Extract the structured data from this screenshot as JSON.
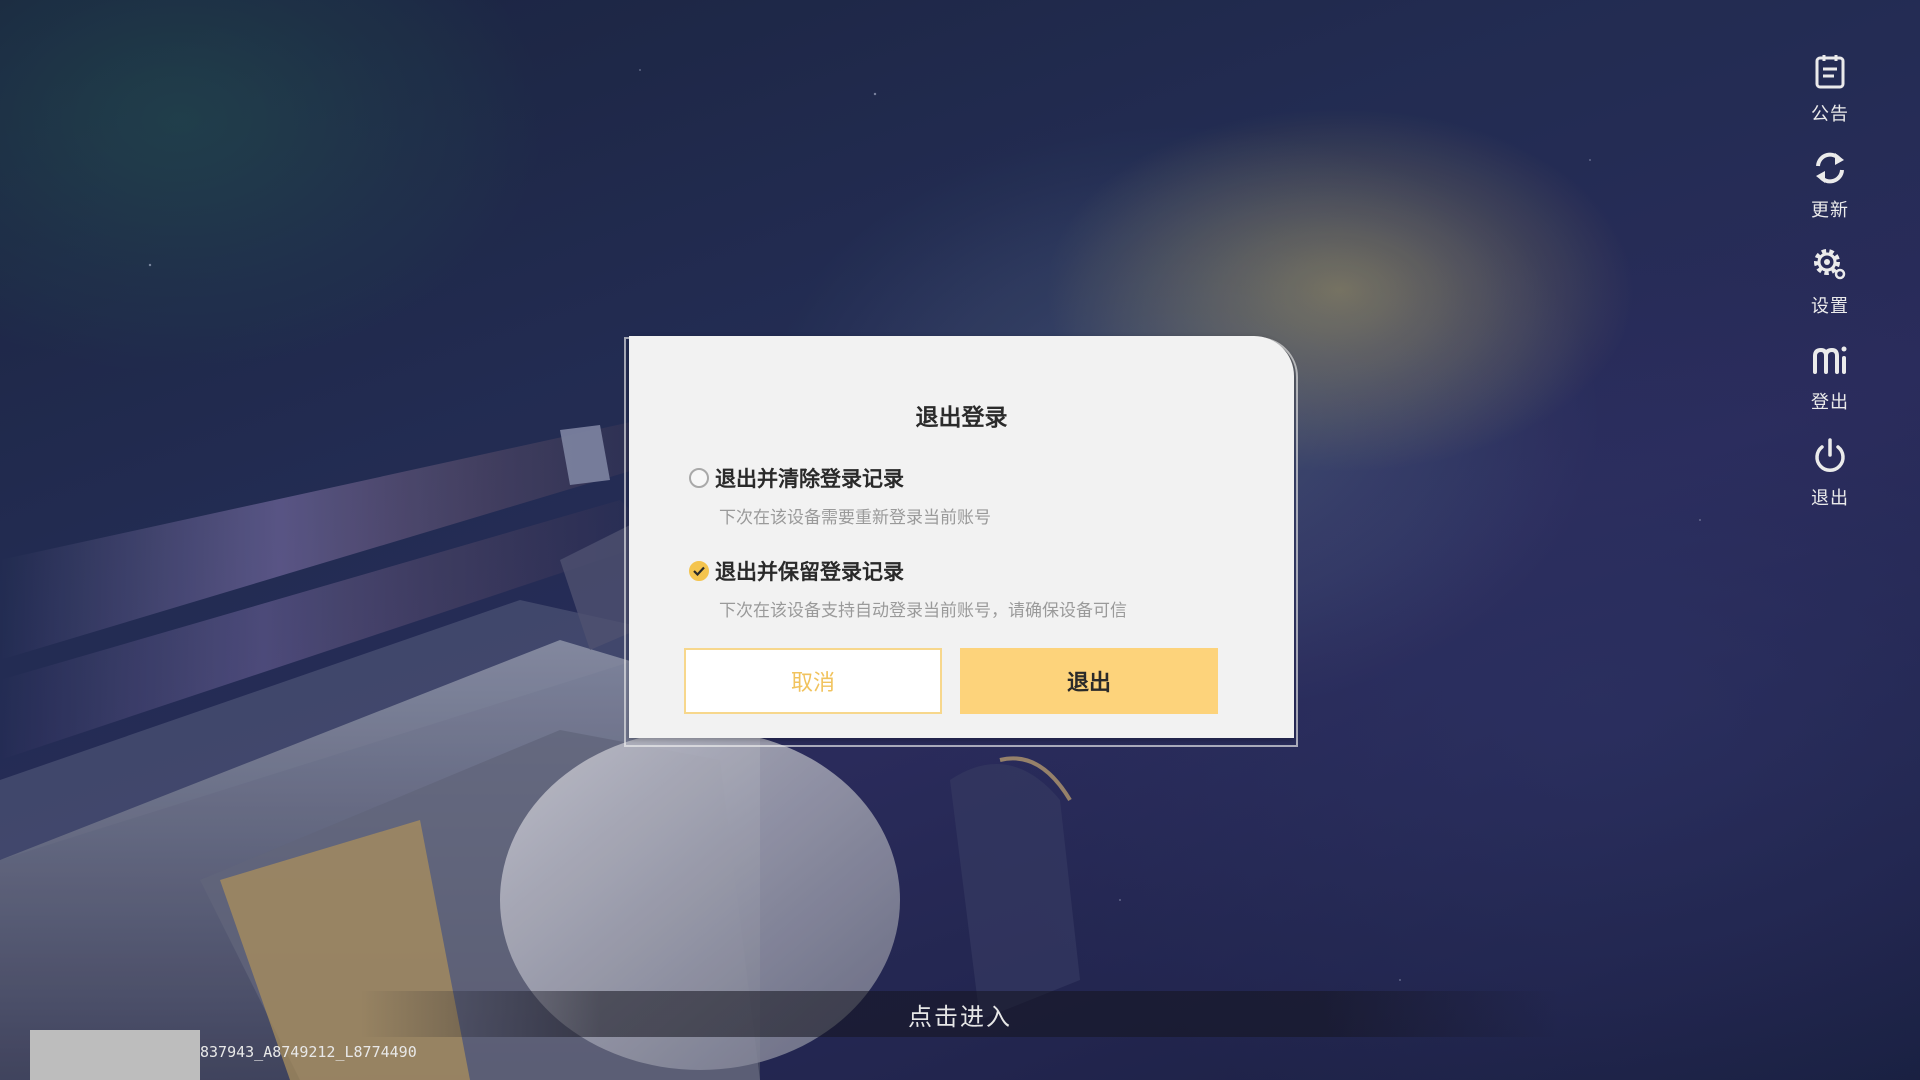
{
  "sidebar": {
    "items": [
      {
        "label": "公告",
        "icon": "notice-icon"
      },
      {
        "label": "更新",
        "icon": "refresh-icon"
      },
      {
        "label": "设置",
        "icon": "gear-icon"
      },
      {
        "label": "登出",
        "icon": "mi-logo-icon"
      },
      {
        "label": "退出",
        "icon": "power-icon"
      }
    ]
  },
  "dialog": {
    "title": "退出登录",
    "options": [
      {
        "label": "退出并清除登录记录",
        "desc": "下次在该设备需要重新登录当前账号",
        "checked": false
      },
      {
        "label": "退出并保留登录记录",
        "desc": "下次在该设备支持自动登录当前账号，请确保设备可信",
        "checked": true
      }
    ],
    "cancel_label": "取消",
    "confirm_label": "退出"
  },
  "bottom": {
    "enter_text": "点击进入",
    "version_text": "837943_A8749212_L8774490"
  },
  "colors": {
    "accent": "#fdd37b",
    "accent_text": "#f1c35e",
    "dialog_bg": "#f2f2f2"
  }
}
